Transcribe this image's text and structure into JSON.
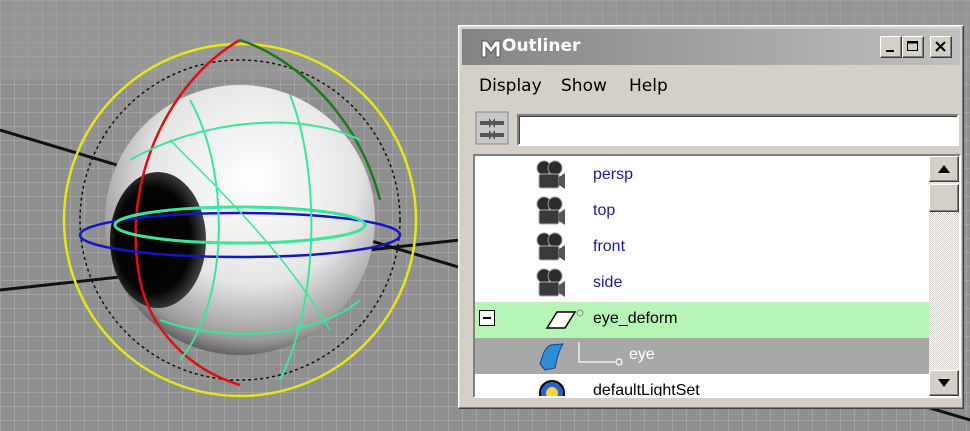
{
  "viewport": {
    "scene": "eye object with deform handle manipulators"
  },
  "window": {
    "title": "Outliner",
    "buttons": {
      "minimize_icon": "minimize-icon",
      "maximize_icon": "maximize-icon",
      "close_icon": "close-icon"
    }
  },
  "menubar": {
    "items": [
      "Display",
      "Show",
      "Help"
    ]
  },
  "filter": {
    "value": "",
    "placeholder": ""
  },
  "outliner": {
    "rows": [
      {
        "label": "persp",
        "icon": "camera-icon"
      },
      {
        "label": "top",
        "icon": "camera-icon"
      },
      {
        "label": "front",
        "icon": "camera-icon"
      },
      {
        "label": "side",
        "icon": "camera-icon"
      },
      {
        "label": "eye_deform",
        "icon": "deformer-icon",
        "expanded": true,
        "selected": true
      },
      {
        "label": "eye",
        "icon": "nurbs-surface-icon",
        "child": true
      },
      {
        "label": "defaultLightSet",
        "icon": "light-set-icon"
      }
    ]
  },
  "colors": {
    "selected_row": "#b7f5b7",
    "child_row": "#a8a8a8",
    "label_blue": "#1a1aa0",
    "title_bar": "#848484"
  }
}
